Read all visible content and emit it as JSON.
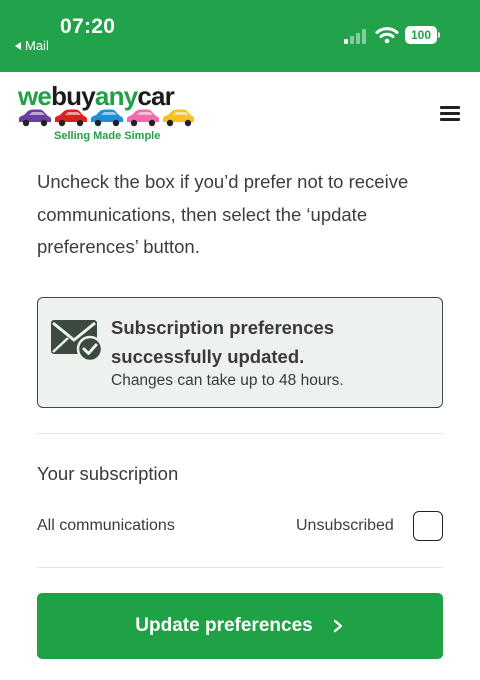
{
  "status_bar": {
    "time": "07:20",
    "back_label": "Mail",
    "battery": "100"
  },
  "header": {
    "logo": {
      "we": "we",
      "buy": "buy",
      "any": "any",
      "car": "car"
    },
    "tagline": "Selling Made Simple",
    "car_colors": [
      "#6b3fa0",
      "#e02020",
      "#1f8fd6",
      "#f26bb0",
      "#f6c21c"
    ]
  },
  "intro": {
    "text": "Uncheck the box if you’d prefer not to receive communications, then select the ‘update preferences’ button."
  },
  "alert": {
    "title": "Subscription preferences successfully updated.",
    "subtitle": "Changes can take up to 48 hours."
  },
  "subscription": {
    "heading": "Your subscription",
    "row_label": "All communications",
    "status": "Unsubscribed",
    "checked": false
  },
  "update_button": {
    "label": "Update preferences"
  },
  "colors": {
    "brand_green": "#1fa146",
    "status_green": "#22a24a",
    "alert_bg": "#eef2ee",
    "alert_icon": "#3c4a3f"
  }
}
